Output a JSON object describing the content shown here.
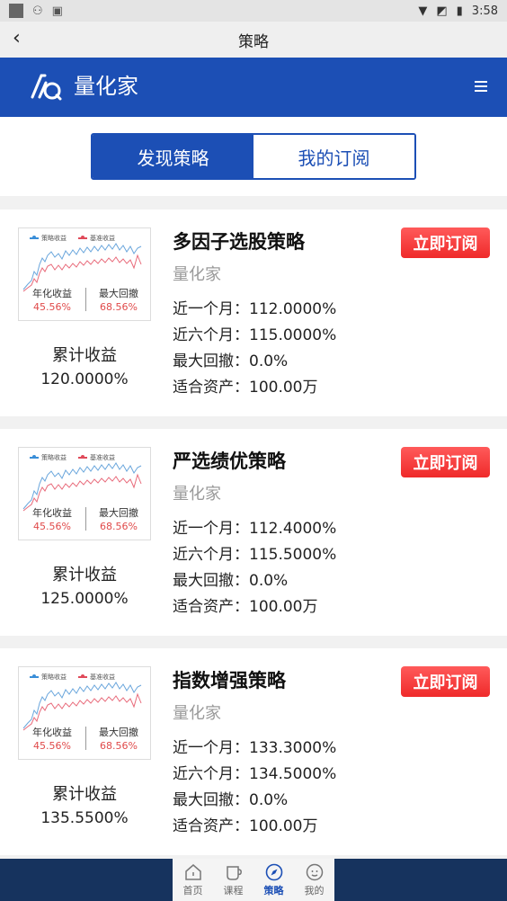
{
  "status": {
    "time": "3:58"
  },
  "header": {
    "title": "策略"
  },
  "brand": {
    "name": "量化家"
  },
  "tabs": [
    {
      "label": "发现策略",
      "active": true
    },
    {
      "label": "我的订阅",
      "active": false
    }
  ],
  "thumb": {
    "legend_strategy": "策略收益",
    "legend_bench": "基准收益",
    "annual_label": "年化收益",
    "annual_value": "45.56%",
    "dd_label": "最大回撤",
    "dd_value": "68.56%"
  },
  "strategies": [
    {
      "name": "多因子选股策略",
      "author": "量化家",
      "cum_label": "累计收益",
      "cum_value": "120.0000%",
      "month": "近一个月：112.0000%",
      "six_month": "近六个月：115.0000%",
      "max_dd": "最大回撤：0.0%",
      "capital": "适合资产：100.00万",
      "subscribe": "立即订阅"
    },
    {
      "name": "严选绩优策略",
      "author": "量化家",
      "cum_label": "累计收益",
      "cum_value": "125.0000%",
      "month": "近一个月：112.4000%",
      "six_month": "近六个月：115.5000%",
      "max_dd": "最大回撤：0.0%",
      "capital": "适合资产：100.00万",
      "subscribe": "立即订阅"
    },
    {
      "name": "指数增强策略",
      "author": "量化家",
      "cum_label": "累计收益",
      "cum_value": "135.5500%",
      "month": "近一个月：133.3000%",
      "six_month": "近六个月：134.5000%",
      "max_dd": "最大回撤：0.0%",
      "capital": "适合资产：100.00万",
      "subscribe": "立即订阅"
    }
  ],
  "nav": [
    {
      "label": "首页",
      "icon": "home-icon",
      "active": false
    },
    {
      "label": "课程",
      "icon": "course-icon",
      "active": false
    },
    {
      "label": "策略",
      "icon": "compass-icon",
      "active": true
    },
    {
      "label": "我的",
      "icon": "profile-icon",
      "active": false
    }
  ],
  "colors": {
    "brand_blue": "#1c4fb5",
    "subscribe_red": "#ef2a2a",
    "footer_navy": "#16335e"
  }
}
